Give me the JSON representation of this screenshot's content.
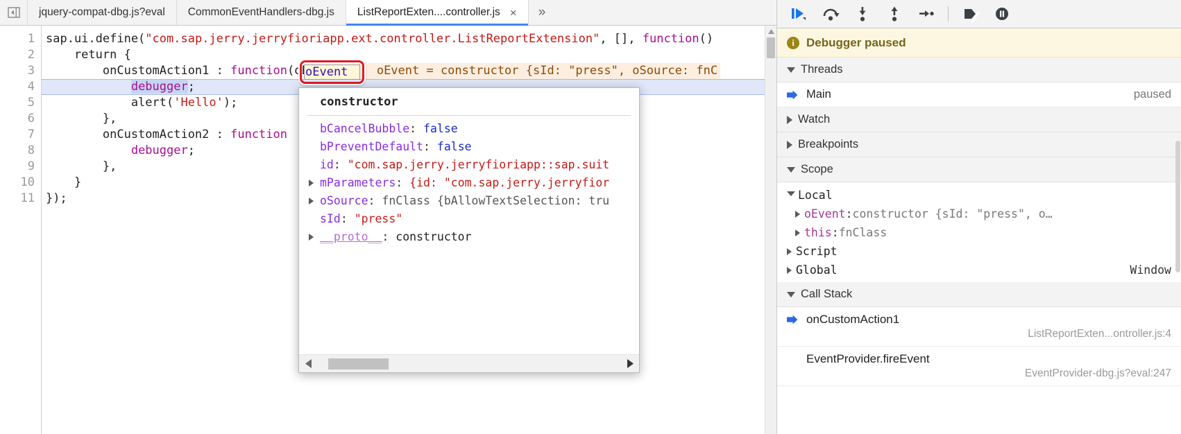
{
  "tabstrip": {
    "nav_back_icon": "navigate-back-icon",
    "tabs": [
      {
        "label": "jquery-compat-dbg.js?eval",
        "active": false,
        "closable": false
      },
      {
        "label": "CommonEventHandlers-dbg.js",
        "active": false,
        "closable": false
      },
      {
        "label": "ListReportExten....controller.js",
        "active": true,
        "closable": true
      }
    ],
    "close_glyph": "×",
    "overflow_glyph": "»"
  },
  "editor": {
    "gutter": [
      "1",
      "2",
      "3",
      "4",
      "5",
      "6",
      "7",
      "8",
      "9",
      "10",
      "11"
    ],
    "lines": [
      {
        "n": 1,
        "segments": [
          {
            "t": "sap.ui.define(",
            "c": "tok-plain"
          },
          {
            "t": "\"com.sap.jerry.jerryfioriapp.ext.controller.ListReportExtension\"",
            "c": "tok-str"
          },
          {
            "t": ", [], ",
            "c": "tok-plain"
          },
          {
            "t": "function",
            "c": "tok-kw"
          },
          {
            "t": "()",
            "c": "tok-plain"
          }
        ]
      },
      {
        "n": 2,
        "segments": [
          {
            "t": "    return {",
            "c": "tok-plain"
          }
        ]
      },
      {
        "n": 3,
        "segments": [
          {
            "t": "        onCustomAction1 : ",
            "c": "tok-plain"
          },
          {
            "t": "function",
            "c": "tok-kw"
          },
          {
            "t": "(oEvent) {",
            "c": "tok-plain"
          }
        ]
      },
      {
        "n": 4,
        "paused": true,
        "segments": [
          {
            "t": "            ",
            "c": "tok-plain"
          },
          {
            "t": "debugger",
            "c": "sel-debug"
          },
          {
            "t": ";",
            "c": "tok-plain"
          }
        ]
      },
      {
        "n": 5,
        "segments": [
          {
            "t": "            alert(",
            "c": "tok-plain"
          },
          {
            "t": "'Hello'",
            "c": "tok-str"
          },
          {
            "t": ");",
            "c": "tok-plain"
          }
        ]
      },
      {
        "n": 6,
        "segments": [
          {
            "t": "        },",
            "c": "tok-plain"
          }
        ]
      },
      {
        "n": 7,
        "segments": [
          {
            "t": "        onCustomAction2 : ",
            "c": "tok-plain"
          },
          {
            "t": "function",
            "c": "tok-kw"
          }
        ]
      },
      {
        "n": 8,
        "segments": [
          {
            "t": "            ",
            "c": "tok-plain"
          },
          {
            "t": "debugger",
            "c": "tok-kw"
          },
          {
            "t": ";",
            "c": "tok-plain"
          }
        ]
      },
      {
        "n": 9,
        "segments": [
          {
            "t": "        },",
            "c": "tok-plain"
          }
        ]
      },
      {
        "n": 10,
        "segments": [
          {
            "t": "    }",
            "c": "tok-plain"
          }
        ]
      },
      {
        "n": 11,
        "segments": [
          {
            "t": "});",
            "c": "tok-plain"
          }
        ]
      }
    ],
    "highlighted_token": "oEvent",
    "inline_hint": "oEvent = constructor {sId: \"press\", oSource: fnC",
    "paused_line": 4
  },
  "popup": {
    "title": "constructor",
    "rows": [
      {
        "expandable": false,
        "key": "bCancelBubble",
        "key_class": "p-key",
        "value": "false",
        "value_class": "p-bool"
      },
      {
        "expandable": false,
        "key": "bPreventDefault",
        "key_class": "p-key",
        "value": "false",
        "value_class": "p-bool"
      },
      {
        "expandable": false,
        "key": "id",
        "key_class": "p-key",
        "value": "\"com.sap.jerry.jerryfioriapp::sap.suit",
        "value_class": "p-str"
      },
      {
        "expandable": true,
        "key": "mParameters",
        "key_class": "p-key",
        "value": "{id: \"com.sap.jerry.jerryfior",
        "value_class": "p-str"
      },
      {
        "expandable": true,
        "key": "oSource",
        "key_class": "p-key",
        "value": "fnClass {bAllowTextSelection: tru",
        "value_class": "p-obj"
      },
      {
        "expandable": false,
        "key": "sId",
        "key_class": "p-key",
        "value": "\"press\"",
        "value_class": "p-str"
      },
      {
        "expandable": true,
        "key": "__proto__",
        "key_class": "p-key-p",
        "value": "constructor",
        "value_class": "p-ctor"
      }
    ],
    "scroll_left_glyph": "◀",
    "scroll_right_glyph": "▶"
  },
  "debugger": {
    "toolbar": [
      {
        "name": "resume-script-execution-button",
        "icon": "resume-icon"
      },
      {
        "name": "step-over-button",
        "icon": "step-over-icon"
      },
      {
        "name": "step-into-button",
        "icon": "step-into-icon"
      },
      {
        "name": "step-out-button",
        "icon": "step-out-icon"
      },
      {
        "name": "step-button",
        "icon": "step-icon"
      },
      {
        "name": "deactivate-breakpoints-button",
        "icon": "deactivate-breakpoints-icon"
      },
      {
        "name": "pause-on-exceptions-button",
        "icon": "pause-on-exceptions-icon"
      }
    ],
    "banner": {
      "icon": "info-icon",
      "text": "Debugger paused"
    },
    "sections": {
      "threads": {
        "label": "Threads",
        "expanded": true,
        "items": [
          {
            "label": "Main",
            "status": "paused",
            "current": true
          }
        ]
      },
      "watch": {
        "label": "Watch",
        "expanded": false
      },
      "breakpoints": {
        "label": "Breakpoints",
        "expanded": false
      },
      "scope": {
        "label": "Scope",
        "expanded": true,
        "entries": [
          {
            "label": "Local",
            "expanded": true,
            "indent": false
          },
          {
            "label": "oEvent",
            "value": "constructor {sId: \"press\", o…",
            "indent": true,
            "expanded": false
          },
          {
            "label": "this",
            "value": "fnClass",
            "indent": true,
            "expanded": false
          },
          {
            "label": "Script",
            "expanded": false,
            "indent": false
          },
          {
            "label": "Global",
            "expanded": false,
            "indent": false,
            "right": "Window"
          }
        ]
      },
      "call_stack": {
        "label": "Call Stack",
        "expanded": true,
        "frames": [
          {
            "fn": "onCustomAction1",
            "location": "ListReportExten...ontroller.js:4",
            "current": true
          },
          {
            "fn": "EventProvider.fireEvent",
            "location": "EventProvider-dbg.js?eval:247",
            "current": false
          }
        ]
      }
    }
  },
  "colors": {
    "accent_blue": "#4285f4",
    "highlight_red": "#e01b24",
    "banner_bg": "#fdf7e2",
    "banner_text": "#76651a",
    "paused_line_bg": "#dfe7f8"
  }
}
